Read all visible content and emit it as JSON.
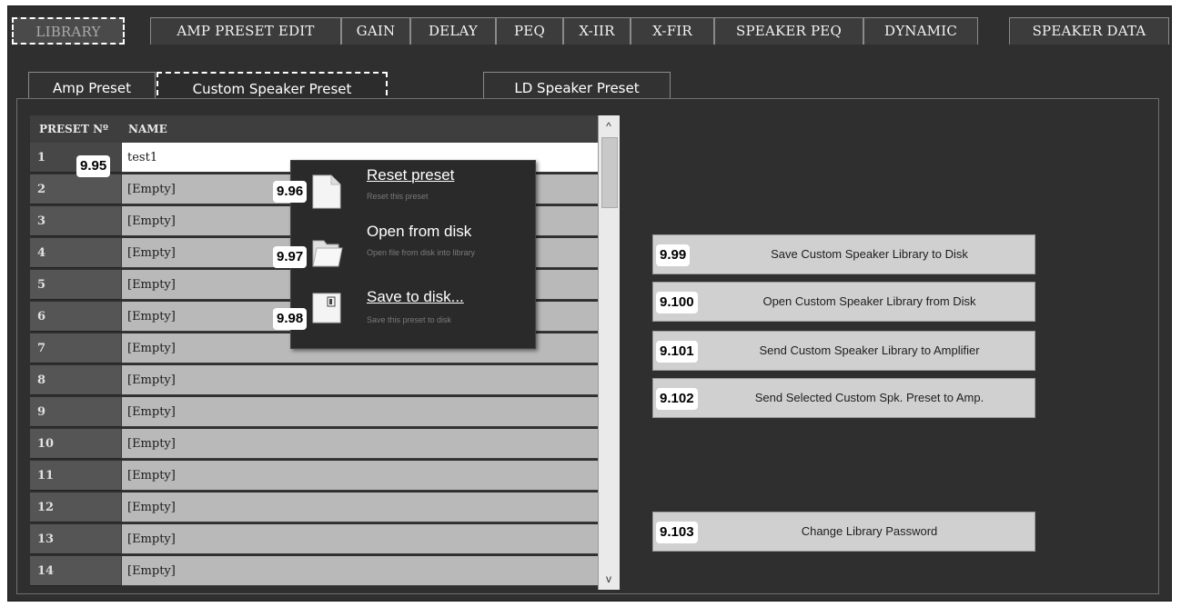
{
  "main_tabs": [
    {
      "label": "LIBRARY",
      "active": true
    },
    {
      "label": "AMP PRESET EDIT"
    },
    {
      "label": "GAIN"
    },
    {
      "label": "DELAY"
    },
    {
      "label": "PEQ"
    },
    {
      "label": "X-IIR"
    },
    {
      "label": "X-FIR"
    },
    {
      "label": "SPEAKER PEQ"
    },
    {
      "label": "DYNAMIC"
    },
    {
      "label": "SPEAKER DATA"
    }
  ],
  "sub_tabs": [
    {
      "label": "Amp Preset"
    },
    {
      "label": "Custom Speaker Preset",
      "active": true
    },
    {
      "label": "LD Speaker Preset"
    }
  ],
  "table": {
    "headers": {
      "preset_no": "PRESET Nº",
      "name": "NAME"
    },
    "rows": [
      {
        "no": "1",
        "name": "test1"
      },
      {
        "no": "2",
        "name": "[Empty]"
      },
      {
        "no": "3",
        "name": "[Empty]"
      },
      {
        "no": "4",
        "name": "[Empty]"
      },
      {
        "no": "5",
        "name": "[Empty]"
      },
      {
        "no": "6",
        "name": "[Empty]"
      },
      {
        "no": "7",
        "name": "[Empty]"
      },
      {
        "no": "8",
        "name": "[Empty]"
      },
      {
        "no": "9",
        "name": "[Empty]"
      },
      {
        "no": "10",
        "name": "[Empty]"
      },
      {
        "no": "11",
        "name": "[Empty]"
      },
      {
        "no": "12",
        "name": "[Empty]"
      },
      {
        "no": "13",
        "name": "[Empty]"
      },
      {
        "no": "14",
        "name": "[Empty]"
      }
    ]
  },
  "context_menu": {
    "items": [
      {
        "label": "Reset preset",
        "desc": "Reset this preset",
        "icon": "page-icon",
        "callout": "9.96"
      },
      {
        "label": "Open from disk",
        "desc": "Open file from disk into library",
        "icon": "folder-icon",
        "callout": "9.97"
      },
      {
        "label": "Save to disk...",
        "desc": "Save this preset to disk",
        "icon": "save-icon",
        "callout": "9.98"
      }
    ]
  },
  "callouts": {
    "table": "9.95"
  },
  "buttons": [
    {
      "label": "Save Custom Speaker Library to Disk",
      "callout": "9.99"
    },
    {
      "label": "Open Custom Speaker Library from Disk",
      "callout": "9.100"
    },
    {
      "label": "Send Custom Speaker Library to Amplifier",
      "callout": "9.101"
    },
    {
      "label": "Send Selected Custom Spk. Preset to Amp.",
      "callout": "9.102"
    },
    {
      "label": "Change Library Password",
      "callout": "9.103"
    }
  ],
  "scrollbar": {
    "up_arrow": "^",
    "down_arrow": "v"
  }
}
